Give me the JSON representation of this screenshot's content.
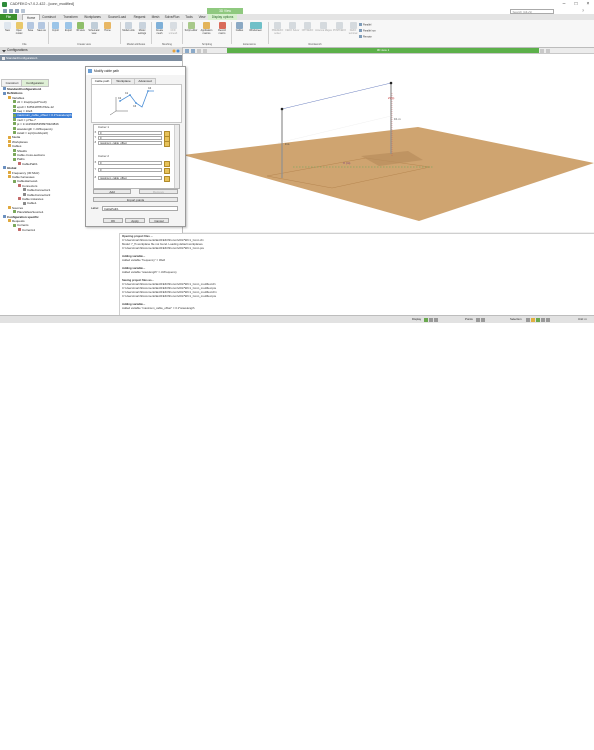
{
  "window": {
    "title": "CADFEKO v7.0.2-422 - [conn_modified]",
    "controls": [
      "–",
      "□",
      "×"
    ]
  },
  "context_badge": "3D View",
  "search": {
    "placeholder": "Search (Alt+S)"
  },
  "menu_tabs": [
    "File",
    "Home",
    "Construct",
    "Transform",
    "Workplanes",
    "Source/Load",
    "Request",
    "Mesh",
    "Solve/Run",
    "Tools",
    "View",
    "Display options"
  ],
  "ribbon": {
    "groups": [
      {
        "label": "File",
        "buttons": [
          "New",
          "Open model",
          "Save",
          "Save as"
        ]
      },
      {
        "label": "Create view",
        "buttons": [
          "Import",
          "Export",
          "3D view",
          "Schematic view",
          "Home"
        ]
      },
      {
        "label": "Model attributes",
        "buttons": [
          "Model units",
          "Model settings"
        ]
      },
      {
        "label": "Meshing",
        "buttons": [
          "Create mesh",
          "CFD unmesh"
        ]
      },
      {
        "label": "Scripting",
        "buttons": [
          "Script editor",
          "Application macros",
          "Record macro"
        ]
      },
      {
        "label": "Extensions",
        "buttons": [
          "Cables",
          "Windscreen"
        ]
      },
      {
        "label": "Run/launch",
        "buttons": [
          "PREFEKO solver",
          "FEKO Solver",
          "OPTFEKO",
          "Antenna Magus",
          "POSTFEKO",
          "FEKO terminal"
        ]
      }
    ],
    "small_buttons": [
      "Parallel",
      "Parallel run",
      "Remote"
    ]
  },
  "left_panel": {
    "title": "Configurations",
    "subtitle": "StandardConfiguration1",
    "tabs": [
      "Construct",
      "Configuration"
    ],
    "active_tab": "Configuration",
    "tree": [
      {
        "label": "StandardConfiguration1",
        "level": 0,
        "bold": true
      },
      {
        "label": "Definitions",
        "level": 0,
        "bold": true
      },
      {
        "label": "Variables",
        "level": 1
      },
      {
        "label": "c0 = 1/sqrt(eps0*mu0)",
        "level": 2
      },
      {
        "label": "eps0 = 8.85418781762e-12",
        "level": 2
      },
      {
        "label": "freq = 10e6",
        "level": 2
      },
      {
        "label": "maximum_cable_offset = 0.1*wavelength",
        "level": 2,
        "selected": true
      },
      {
        "label": "mu0 = pi*4e-7",
        "level": 2
      },
      {
        "label": "pi = 3.14159265358979323846",
        "level": 2
      },
      {
        "label": "wavelength = c0/frequency",
        "level": 2
      },
      {
        "label": "zeta0 = sqrt(mu0/eps0)",
        "level": 2
      },
      {
        "label": "Media",
        "level": 1
      },
      {
        "label": "Workplanes",
        "level": 1
      },
      {
        "label": "Cables",
        "level": 1
      },
      {
        "label": "Shields",
        "level": 2
      },
      {
        "label": "Cable cross-sections",
        "level": 2
      },
      {
        "label": "Paths",
        "level": 2
      },
      {
        "label": "CablePath1",
        "level": 3
      },
      {
        "label": "Global",
        "level": 0,
        "bold": true
      },
      {
        "label": "Frequency (30 MHz)",
        "level": 1
      },
      {
        "label": "Cable harnesses",
        "level": 1
      },
      {
        "label": "CableHarness1",
        "level": 2
      },
      {
        "label": "Connectors",
        "level": 3
      },
      {
        "label": "CableConnector1",
        "level": 4
      },
      {
        "label": "CableConnector2",
        "level": 4
      },
      {
        "label": "Cable instances",
        "level": 3
      },
      {
        "label": "Cable1",
        "level": 4
      },
      {
        "label": "Sources",
        "level": 1
      },
      {
        "label": "PlaneWaveSource1",
        "level": 2
      },
      {
        "label": "Configuration specific",
        "level": 0,
        "bold": true
      },
      {
        "label": "Requests",
        "level": 1
      },
      {
        "label": "Currents",
        "level": 2
      },
      {
        "label": "Currents1",
        "level": 3
      }
    ]
  },
  "dialog": {
    "title": "Modify cable path",
    "tabs": [
      "Cable path",
      "Workplane",
      "Advanced"
    ],
    "active_tab": "Cable path",
    "preview_labels": [
      "C1",
      "C2",
      "C3",
      "C4"
    ],
    "corners": [
      {
        "title": "Corner 1",
        "x": "0",
        "y": "0",
        "z": "maximum_cable_offset"
      },
      {
        "title": "Corner 2",
        "x": "0",
        "y": "0",
        "z": "maximum_cable_offset"
      }
    ],
    "add_label": "Add",
    "remove_label": "Remove",
    "import_label": "Import points",
    "label_caption": "Label",
    "label_value": "CablePath1",
    "ok": "OK",
    "apply": "Apply",
    "cancel": "Cancel"
  },
  "toolbar": {
    "tab_label": "3D view 1"
  },
  "viewport": {
    "labels": [
      "Z(m)",
      "0.1 m",
      "X (m)",
      "0 m"
    ],
    "ground_color": "#cfa470",
    "pole_color": "#909090",
    "wire_color": "#6b7fbf"
  },
  "console": {
    "lines": [
      {
        "text": "Opening project files ...",
        "bold": true
      },
      {
        "text": "C:\\Users\\marin\\Documents\\Ext\\FEKO\\Forum\\2017\\RC1_Conn.cfx"
      },
      {
        "text": "Model: 7_fh workplane file not found. Loading default workplanes."
      },
      {
        "text": "C:\\Users\\marin\\Documents\\Ext\\FEKO\\Forum\\2017\\RC1_Conn.pre"
      },
      {
        "text": ""
      },
      {
        "text": "Adding variable...",
        "bold": true
      },
      {
        "text": "Added variable \"frequency\" = 30e6"
      },
      {
        "text": ""
      },
      {
        "text": "Adding variable...",
        "bold": true
      },
      {
        "text": "Added variable \"wavelength\" = c0/frequency"
      },
      {
        "text": ""
      },
      {
        "text": "Saving project files as...",
        "bold": true
      },
      {
        "text": "C:\\Users\\marin\\Documents\\Ext\\FEKO\\Forum\\2017\\RC1_Conn_modified.cfx"
      },
      {
        "text": "C:\\Users\\marin\\Documents\\Ext\\FEKO\\Forum\\2017\\RC1_Conn_modified.pre"
      },
      {
        "text": "C:\\Users\\marin\\Documents\\Ext\\FEKO\\Forum\\2017\\RC1_Conn_modified.cfm"
      },
      {
        "text": "C:\\Users\\marin\\Documents\\Ext\\FEKO\\Forum\\2017\\RC1_Conn_modified.pre"
      },
      {
        "text": ""
      },
      {
        "text": "Adding variable...",
        "bold": true
      },
      {
        "text": "Added variable \"maximum_cable_offset\" = 0.1*wavelength"
      }
    ]
  },
  "statusbar": {
    "display": "Display",
    "points": "Points",
    "selection": "Selection",
    "unit": "Unit: m"
  }
}
